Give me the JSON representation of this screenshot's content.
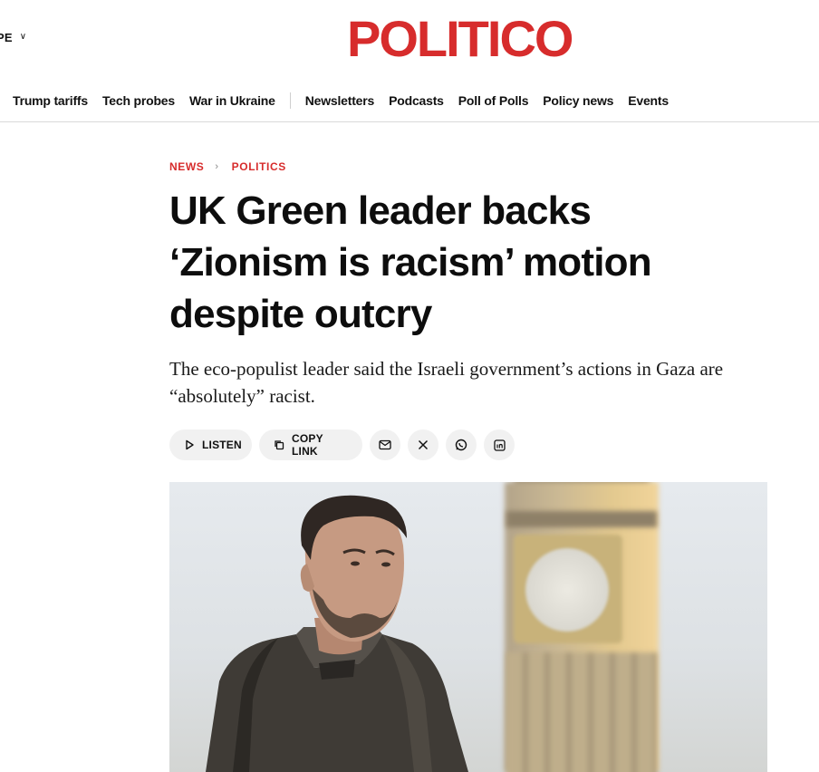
{
  "header": {
    "edition_label": "PE",
    "logo_text": "POLITICO",
    "brand_color": "#d72c2c",
    "nav_left": [
      "Trump tariffs",
      "Tech probes",
      "War in Ukraine"
    ],
    "nav_right": [
      "Newsletters",
      "Podcasts",
      "Poll of Polls",
      "Policy news",
      "Events"
    ]
  },
  "article": {
    "breadcrumb": [
      "NEWS",
      "POLITICS"
    ],
    "headline": "UK Green leader backs ‘Zionism is racism’ motion despite outcry",
    "dek": "The eco-populist leader said the Israeli government’s actions in Gaza are “absolutely” racist.",
    "share": {
      "listen_label": "LISTEN",
      "copy_link_label": "COPY LINK",
      "icons": [
        "email-icon",
        "x-icon",
        "whatsapp-icon",
        "linkedin-icon"
      ]
    },
    "hero_image": {
      "subject": "man in dark puffer jacket in front of blurred clock tower"
    }
  }
}
